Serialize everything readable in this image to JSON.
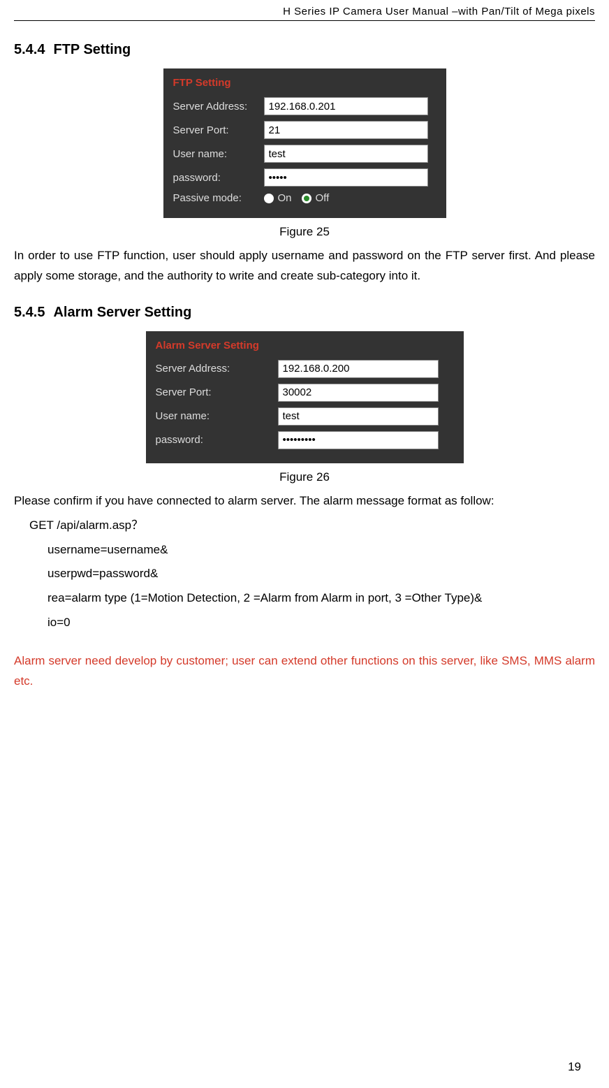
{
  "header": "H Series IP Camera User Manual –with Pan/Tilt of Mega pixels",
  "section1": {
    "number": "5.4.4",
    "title": "FTP Setting"
  },
  "ftp_panel": {
    "title": "FTP Setting",
    "server_address_label": "Server Address:",
    "server_address_value": "192.168.0.201",
    "server_port_label": "Server Port:",
    "server_port_value": "21",
    "username_label": "User name:",
    "username_value": "test",
    "password_label": "password:",
    "password_value": "•••••",
    "passive_label": "Passive mode:",
    "on_label": "On",
    "off_label": "Off"
  },
  "figure25": "Figure 25",
  "ftp_desc": "In order to use FTP function, user should apply username and password on the FTP server first. And please apply some storage, and the authority to write and create sub-category into it.",
  "section2": {
    "number": "5.4.5",
    "title": "Alarm Server Setting"
  },
  "alarm_panel": {
    "title": "Alarm Server Setting",
    "server_address_label": "Server Address:",
    "server_address_value": "192.168.0.200",
    "server_port_label": "Server Port:",
    "server_port_value": "30002",
    "username_label": "User name:",
    "username_value": "test",
    "password_label": "password:",
    "password_value": "•••••••••"
  },
  "figure26": "Figure 26",
  "alarm_intro": "Please confirm if you have connected to alarm server. The alarm message format as follow:",
  "alarm_code": {
    "line1": "GET /api/alarm.asp？",
    "line2": "username=username&",
    "line3": "userpwd=password&",
    "line4": "rea=alarm type (1=Motion Detection, 2 =Alarm from Alarm in port, 3 =Other Type)&",
    "line5": "io=0"
  },
  "alarm_note": "Alarm server need develop by customer; user can extend other functions on this server, like SMS, MMS alarm etc.",
  "page_number": "19"
}
